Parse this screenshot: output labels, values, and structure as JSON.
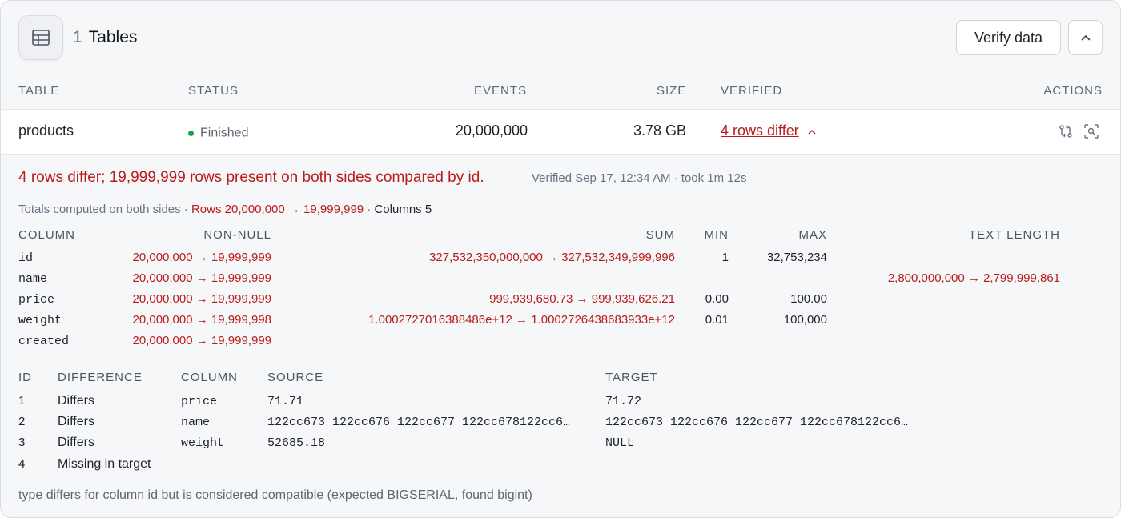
{
  "header": {
    "count": "1",
    "title": "Tables",
    "verify_label": "Verify data"
  },
  "table_headers": {
    "table": "TABLE",
    "status": "STATUS",
    "events": "EVENTS",
    "size": "SIZE",
    "verified": "VERIFIED",
    "actions": "ACTIONS"
  },
  "row": {
    "name": "products",
    "status": "Finished",
    "events": "20,000,000",
    "size": "3.78 GB",
    "verified": "4 rows differ"
  },
  "details": {
    "summary": "4 rows differ; 19,999,999 rows present on both sides compared by id.",
    "verified_at": "Verified Sep 17, 12:34 AM · took 1m 12s",
    "totals_prefix": "Totals computed on both sides ·",
    "totals_rows": "Rows 20,000,000 → 19,999,999",
    "totals_sep": "·",
    "totals_columns": "Columns 5",
    "stats_headers": {
      "column": "COLUMN",
      "non_null": "NON-NULL",
      "sum": "SUM",
      "min": "MIN",
      "max": "MAX",
      "text_length": "TEXT LENGTH"
    },
    "stats_rows": [
      {
        "column": "id",
        "non_null": "20,000,000 → 19,999,999",
        "sum": "327,532,350,000,000 → 327,532,349,999,996",
        "min": "1",
        "max": "32,753,234",
        "text_length": ""
      },
      {
        "column": "name",
        "non_null": "20,000,000 → 19,999,999",
        "sum": "",
        "min": "",
        "max": "",
        "text_length": "2,800,000,000 → 2,799,999,861"
      },
      {
        "column": "price",
        "non_null": "20,000,000 → 19,999,999",
        "sum": "999,939,680.73 → 999,939,626.21",
        "min": "0.00",
        "max": "100.00",
        "text_length": ""
      },
      {
        "column": "weight",
        "non_null": "20,000,000 → 19,999,998",
        "sum": "1.0002727016388486e+12 → 1.0002726438683933e+12",
        "min": "0.01",
        "max": "100,000",
        "text_length": ""
      },
      {
        "column": "created",
        "non_null": "20,000,000 → 19,999,999",
        "sum": "",
        "min": "",
        "max": "",
        "text_length": ""
      }
    ],
    "diff_headers": {
      "id": "ID",
      "difference": "DIFFERENCE",
      "column": "COLUMN",
      "source": "SOURCE",
      "target": "TARGET"
    },
    "diff_rows": [
      {
        "id": "1",
        "difference": "Differs",
        "column": "price",
        "source": "71.71",
        "target": "71.72"
      },
      {
        "id": "2",
        "difference": "Differs",
        "column": "name",
        "source": "122cc673 122cc676 122cc677 122cc678122cc6…",
        "target": "122cc673 122cc676 122cc677 122cc678122cc6…"
      },
      {
        "id": "3",
        "difference": "Differs",
        "column": "weight",
        "source": "52685.18",
        "target": "NULL"
      },
      {
        "id": "4",
        "difference": "Missing in target",
        "column": "",
        "source": "",
        "target": ""
      }
    ],
    "footnote": "type differs for column id but is considered compatible (expected BIGSERIAL, found bigint)"
  },
  "colors": {
    "error": "#b91c1c",
    "success": "#16a34a",
    "muted": "#6b7280",
    "panel": "#f6f7f9"
  },
  "icons": [
    "table-icon",
    "chevron-up-icon",
    "compare-icon",
    "inspect-icon"
  ]
}
